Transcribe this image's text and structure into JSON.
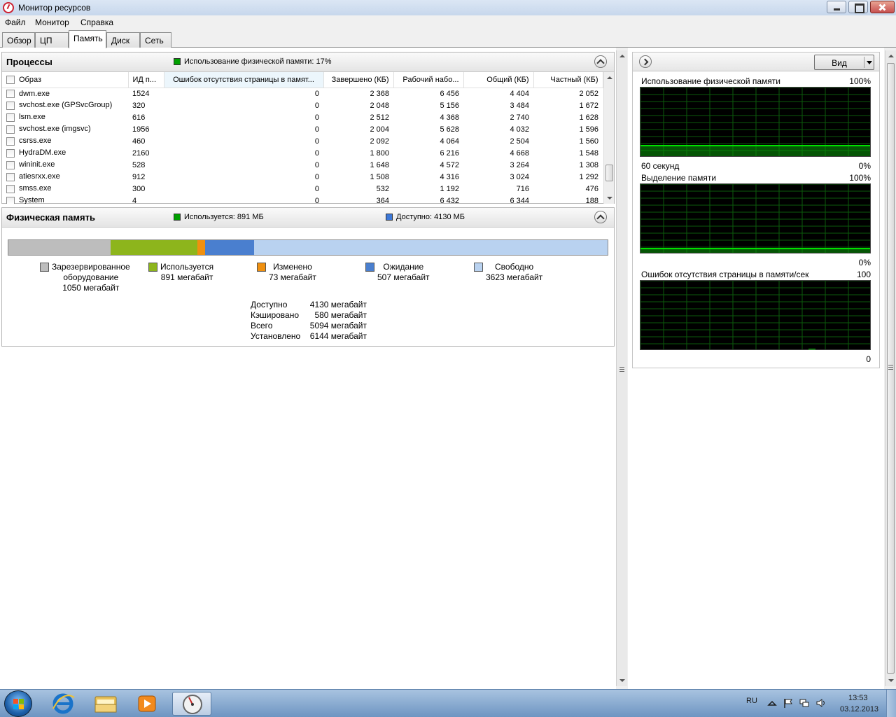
{
  "window": {
    "title": "Монитор ресурсов"
  },
  "menu": [
    "Файл",
    "Монитор",
    "Справка"
  ],
  "tabs": [
    "Обзор",
    "ЦП",
    "Память",
    "Диск",
    "Сеть"
  ],
  "active_tab": "Память",
  "processes": {
    "title": "Процессы",
    "info_label": "Использование физической памяти: 17%",
    "info_color": "#00a000",
    "columns": [
      "Образ",
      "ИД п...",
      "Ошибок отсутствия страницы в памят...",
      "Завершено (КБ)",
      "Рабочий набо...",
      "Общий (КБ)",
      "Частный (КБ)"
    ],
    "sorted_column": 2,
    "rows": [
      {
        "name": "dwm.exe",
        "pid": "1524",
        "faults": "0",
        "commit": "2 368",
        "working": "6 456",
        "shared": "4 404",
        "private": "2 052"
      },
      {
        "name": "svchost.exe (GPSvcGroup)",
        "pid": "320",
        "faults": "0",
        "commit": "2 048",
        "working": "5 156",
        "shared": "3 484",
        "private": "1 672"
      },
      {
        "name": "lsm.exe",
        "pid": "616",
        "faults": "0",
        "commit": "2 512",
        "working": "4 368",
        "shared": "2 740",
        "private": "1 628"
      },
      {
        "name": "svchost.exe (imgsvc)",
        "pid": "1956",
        "faults": "0",
        "commit": "2 004",
        "working": "5 628",
        "shared": "4 032",
        "private": "1 596"
      },
      {
        "name": "csrss.exe",
        "pid": "460",
        "faults": "0",
        "commit": "2 092",
        "working": "4 064",
        "shared": "2 504",
        "private": "1 560"
      },
      {
        "name": "HydraDM.exe",
        "pid": "2160",
        "faults": "0",
        "commit": "1 800",
        "working": "6 216",
        "shared": "4 668",
        "private": "1 548"
      },
      {
        "name": "wininit.exe",
        "pid": "528",
        "faults": "0",
        "commit": "1 648",
        "working": "4 572",
        "shared": "3 264",
        "private": "1 308"
      },
      {
        "name": "atiesrxx.exe",
        "pid": "912",
        "faults": "0",
        "commit": "1 508",
        "working": "4 316",
        "shared": "3 024",
        "private": "1 292"
      },
      {
        "name": "smss.exe",
        "pid": "300",
        "faults": "0",
        "commit": "532",
        "working": "1 192",
        "shared": "716",
        "private": "476"
      },
      {
        "name": "System",
        "pid": "4",
        "faults": "0",
        "commit": "364",
        "working": "6 432",
        "shared": "6 344",
        "private": "188"
      }
    ]
  },
  "physical_memory": {
    "title": "Физическая память",
    "used_label": "Используется: 891 МБ",
    "used_color": "#00a000",
    "available_label": "Доступно: 4130 МБ",
    "available_color": "#3c78d8",
    "bar": [
      {
        "name": "reserved",
        "mb": 1050,
        "color": "#bdbdbd"
      },
      {
        "name": "in_use",
        "mb": 891,
        "color": "#8db51c"
      },
      {
        "name": "modified",
        "mb": 73,
        "color": "#f0900f"
      },
      {
        "name": "standby",
        "mb": 507,
        "color": "#4a7fcf"
      },
      {
        "name": "free",
        "mb": 3623,
        "color": "#b9d2f0"
      }
    ],
    "legend": [
      {
        "label": "Зарезервированное\nоборудование",
        "value": "1050 мегабайт",
        "color": "#bdbdbd"
      },
      {
        "label": "Используется",
        "value": "891 мегабайт",
        "color": "#8db51c"
      },
      {
        "label": "Изменено",
        "value": "73 мегабайт",
        "color": "#f0900f"
      },
      {
        "label": "Ожидание",
        "value": "507 мегабайт",
        "color": "#4a7fcf"
      },
      {
        "label": "Свободно",
        "value": "3623 мегабайт",
        "color": "#b9d2f0"
      }
    ],
    "stats": [
      {
        "key": "Доступно",
        "value": "4130 мегабайт"
      },
      {
        "key": "Кэшировано",
        "value": "580 мегабайт"
      },
      {
        "key": "Всего",
        "value": "5094 мегабайт"
      },
      {
        "key": "Установлено",
        "value": "6144 мегабайт"
      }
    ]
  },
  "right_panel": {
    "view_button": "Вид",
    "graphs": [
      {
        "title": "Использование физической памяти",
        "max_label": "100%",
        "bottom_left": "60 секунд",
        "bottom_right": "0%",
        "level": 0.17
      },
      {
        "title": "Выделение памяти",
        "max_label": "100%",
        "bottom_left": "",
        "bottom_right": "0%",
        "level": 0.08
      },
      {
        "title": "Ошибок отсутствия страницы в памяти/сек",
        "max_label": "100",
        "bottom_left": "",
        "bottom_right": "0",
        "level": 0.0
      }
    ]
  },
  "taskbar": {
    "language": "RU",
    "time": "13:53",
    "date": "03.12.2013"
  }
}
